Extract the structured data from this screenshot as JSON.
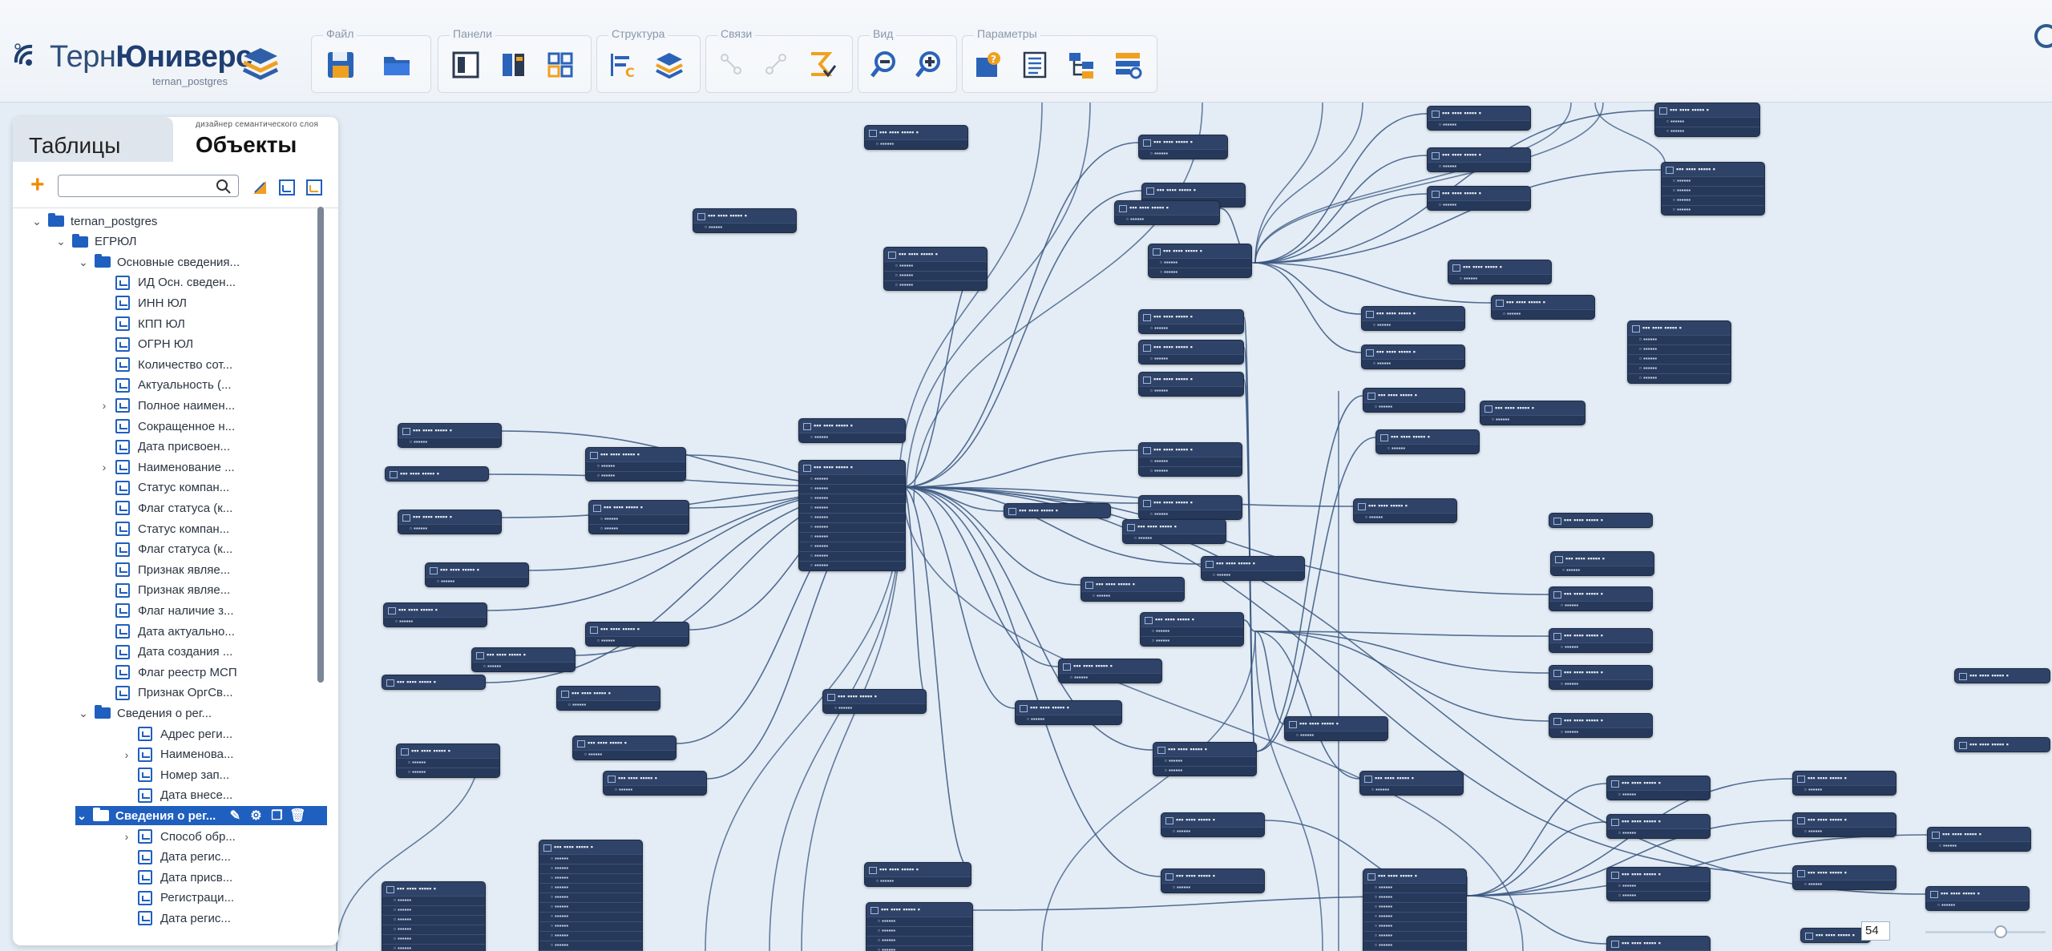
{
  "app": {
    "brand_prefix": "Терн",
    "brand_main": "Юниверс",
    "subtitle": "ternan_postgres"
  },
  "toolbar": {
    "groups": [
      {
        "label": "Файл"
      },
      {
        "label": "Панели"
      },
      {
        "label": "Структура"
      },
      {
        "label": "Связи"
      },
      {
        "label": "Вид"
      },
      {
        "label": "Параметры"
      }
    ]
  },
  "panel": {
    "tab_tables": "Таблицы",
    "tab_objects_caption": "дизайнер семантического слоя",
    "tab_objects": "Объекты",
    "search_placeholder": ""
  },
  "tree": [
    {
      "label": "ternan_postgres",
      "type": "folder",
      "level": 0,
      "chev": "⌄"
    },
    {
      "label": "ЕГРЮЛ",
      "type": "folder",
      "level": 1,
      "chev": "⌄"
    },
    {
      "label": "Основные сведения...",
      "type": "folder",
      "level": 2,
      "chev": "⌄"
    },
    {
      "label": "ИД Осн. сведен...",
      "type": "attr",
      "level": 3,
      "chev": ""
    },
    {
      "label": "ИНН ЮЛ",
      "type": "attr",
      "level": 3,
      "chev": ""
    },
    {
      "label": "КПП ЮЛ",
      "type": "attr",
      "level": 3,
      "chev": ""
    },
    {
      "label": "ОГРН ЮЛ",
      "type": "attr",
      "level": 3,
      "chev": ""
    },
    {
      "label": "Количество сот...",
      "type": "attr",
      "level": 3,
      "chev": ""
    },
    {
      "label": "Актуальность (...",
      "type": "attr",
      "level": 3,
      "chev": ""
    },
    {
      "label": "Полное наимен...",
      "type": "attr",
      "level": 3,
      "chev": "›"
    },
    {
      "label": "Сокращенное н...",
      "type": "attr",
      "level": 3,
      "chev": ""
    },
    {
      "label": "Дата присвоен...",
      "type": "attr",
      "level": 3,
      "chev": ""
    },
    {
      "label": "Наименование ...",
      "type": "attr",
      "level": 3,
      "chev": "›"
    },
    {
      "label": "Статус компан...",
      "type": "attr",
      "level": 3,
      "chev": ""
    },
    {
      "label": "Флаг статуса (к...",
      "type": "attr",
      "level": 3,
      "chev": ""
    },
    {
      "label": "Статус компан...",
      "type": "attr",
      "level": 3,
      "chev": ""
    },
    {
      "label": "Флаг статуса (к...",
      "type": "attr",
      "level": 3,
      "chev": ""
    },
    {
      "label": "Признак являе...",
      "type": "attr",
      "level": 3,
      "chev": ""
    },
    {
      "label": "Признак являе...",
      "type": "attr",
      "level": 3,
      "chev": ""
    },
    {
      "label": "Флаг наличие з...",
      "type": "attr",
      "level": 3,
      "chev": ""
    },
    {
      "label": "Дата актуально...",
      "type": "attr",
      "level": 3,
      "chev": ""
    },
    {
      "label": "Дата создания ...",
      "type": "attr",
      "level": 3,
      "chev": ""
    },
    {
      "label": "Флаг реестр МСП",
      "type": "attr",
      "level": 3,
      "chev": ""
    },
    {
      "label": "Признак ОргСв...",
      "type": "attr",
      "level": 3,
      "chev": ""
    },
    {
      "label": "Сведения о рег...",
      "type": "folder",
      "level": 2,
      "chev": "⌄"
    },
    {
      "label": "Адрес реги...",
      "type": "attr",
      "level": 4,
      "chev": ""
    },
    {
      "label": "Наименова...",
      "type": "attr",
      "level": 4,
      "chev": "›"
    },
    {
      "label": "Номер зап...",
      "type": "attr",
      "level": 4,
      "chev": ""
    },
    {
      "label": "Дата внесе...",
      "type": "attr",
      "level": 4,
      "chev": ""
    },
    {
      "label": "Сведения о рег...",
      "type": "folder",
      "level": 2,
      "chev": "⌄",
      "selected": true
    },
    {
      "label": "Способ обр...",
      "type": "attr",
      "level": 4,
      "chev": "›"
    },
    {
      "label": "Дата регис...",
      "type": "attr",
      "level": 4,
      "chev": ""
    },
    {
      "label": "Дата присв...",
      "type": "attr",
      "level": 4,
      "chev": ""
    },
    {
      "label": "Регистраци...",
      "type": "attr",
      "level": 4,
      "chev": ""
    },
    {
      "label": "Дата регис...",
      "type": "attr",
      "level": 4,
      "chev": ""
    }
  ],
  "zoom": {
    "value": "54"
  },
  "colors": {
    "accent": "#1f5fbf",
    "node": "#2f4368",
    "canvas": "#e4edf6",
    "link": "#3a5680"
  },
  "icons": [
    "save-icon",
    "open-folder-icon",
    "panel-icon",
    "panel-columns-icon",
    "panel-grid-icon",
    "structure-icon",
    "layers-icon",
    "link-add-icon",
    "link-remove-icon",
    "formula-icon",
    "zoom-out-icon",
    "zoom-in-icon",
    "help-icon",
    "list-icon",
    "hierarchy-icon",
    "settings-icon"
  ]
}
